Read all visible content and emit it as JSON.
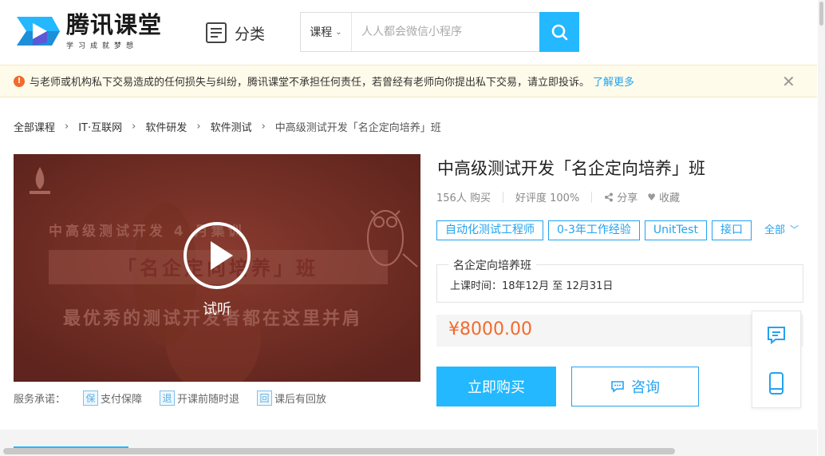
{
  "header": {
    "logo_title": "腾讯课堂",
    "logo_sub": "学习成就梦想",
    "category_label": "分类",
    "search": {
      "scope": "课程",
      "placeholder": "人人都会微信小程序"
    }
  },
  "notice": {
    "text": "与老师或机构私下交易造成的任何损失与纠纷，腾讯课堂不承担任何责任，若曾经有老师向你提出私下交易，请立即投诉。",
    "link": "了解更多",
    "close": "✕"
  },
  "breadcrumb": [
    "全部课程",
    "IT·互联网",
    "软件研发",
    "软件测试"
  ],
  "breadcrumb_current": "中高级测试开发「名企定向培养」班",
  "breadcrumb_sep": "›",
  "video": {
    "line1": "中高级测试开发 4 月集训",
    "line2": "「名企定向培养」班",
    "line3": "最优秀的测试开发者都在这里并肩",
    "play_label": "试听"
  },
  "promise": {
    "label": "服务承诺：",
    "items": [
      {
        "icon": "保",
        "text": "支付保障"
      },
      {
        "icon": "退",
        "text": "开课前随时退"
      },
      {
        "icon": "回",
        "text": "课后有回放"
      }
    ]
  },
  "course": {
    "title": "中高级测试开发「名企定向培养」班",
    "buyers": "156人 购买",
    "rating": "好评度 100%",
    "share": "分享",
    "favorite": "收藏",
    "tags": [
      "自动化测试工程师",
      "0-3年工作经验",
      "UnitTest",
      "接口"
    ],
    "tags_all": "全部",
    "class_name": "名企定向培养班",
    "class_time": "上课时间：18年12月 至 12月31日",
    "price": "¥8000.00",
    "buy_label": "立即购买",
    "consult_label": "咨询"
  },
  "colors": {
    "accent": "#23b8ff",
    "link": "#23a3f0",
    "price": "#f26a2c",
    "notice_bg": "#fffbea"
  }
}
